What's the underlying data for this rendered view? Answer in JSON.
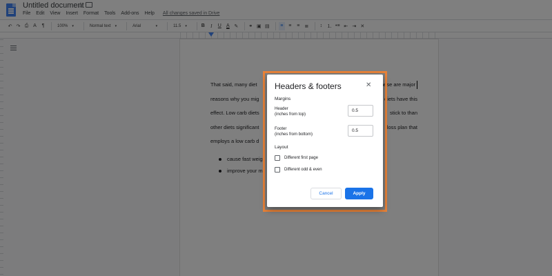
{
  "app": {
    "doc_title": "Untitled document",
    "icons": [
      "docs-logo-icon",
      "star-icon",
      "move-to-folder-icon"
    ]
  },
  "menu": {
    "items": [
      "File",
      "Edit",
      "View",
      "Insert",
      "Format",
      "Tools",
      "Add-ons",
      "Help"
    ],
    "saved_status": "All changes saved in Drive"
  },
  "toolbar": {
    "zoom": "100%",
    "style": "Normal text",
    "font": "Arial",
    "size": "11.5",
    "icons": [
      "undo-icon",
      "redo-icon",
      "print-icon",
      "spellcheck-icon",
      "paint-format-icon",
      "bold-icon",
      "italic-icon",
      "underline-icon",
      "text-color-icon",
      "highlight-icon",
      "link-icon",
      "comment-icon",
      "image-icon",
      "align-left-icon",
      "align-center-icon",
      "align-right-icon",
      "justify-icon",
      "line-spacing-icon",
      "numbered-list-icon",
      "bulleted-list-icon",
      "decrease-indent-icon",
      "increase-indent-icon",
      "clear-formatting-icon"
    ]
  },
  "document": {
    "lines": [
      "That said, many diet",
      "reasons why you mig",
      "effect. Low carb diets",
      "other diets significant",
      "employs a low carb d"
    ],
    "lines_right": [
      "These are major",
      "diets have this",
      "stick to than",
      "loss plan that",
      ""
    ],
    "bullets": [
      "cause fast weig",
      "improve your m"
    ]
  },
  "dialog": {
    "title": "Headers & footers",
    "margins_label": "Margins",
    "header_label_line1": "Header",
    "header_label_line2": "(inches from top)",
    "header_value": "0.5",
    "footer_label_line1": "Footer",
    "footer_label_line2": "(inches from bottom)",
    "footer_value": "0.5",
    "layout_label": "Layout",
    "option_first_page": "Different first page",
    "option_odd_even": "Different odd & even",
    "cancel_label": "Cancel",
    "apply_label": "Apply",
    "highlight_color": "#e8833a",
    "primary_color": "#1a73e8"
  }
}
